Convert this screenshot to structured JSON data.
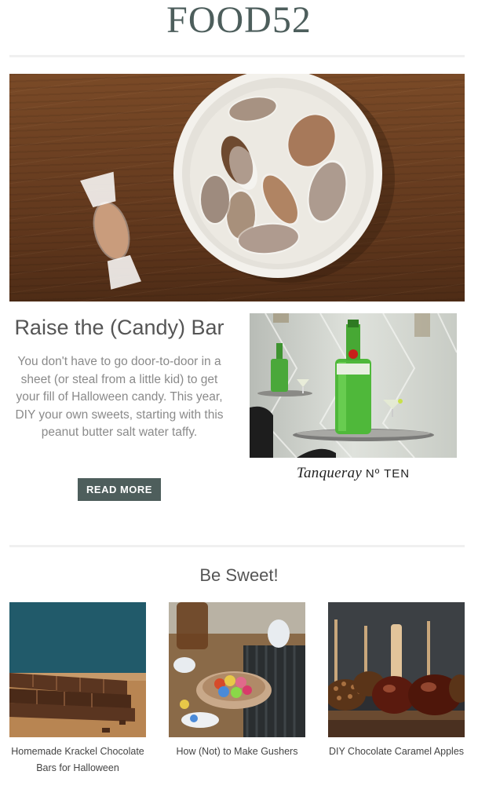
{
  "brand": {
    "logo_text": "FOOD52"
  },
  "feature": {
    "title": "Raise the (Candy) Bar",
    "body": "You don't have to go door-to-door in a sheet (or steal from a little kid) to get your fill of Halloween candy. This year, DIY your own sweets, starting with this peanut butter salt water taffy.",
    "button_label": "READ MORE"
  },
  "ad": {
    "brand_script": "Tanqueray",
    "brand_suffix": "Nº TEN"
  },
  "section": {
    "title": "Be Sweet!"
  },
  "cards": [
    {
      "caption": "Homemade Krackel Chocolate Bars for Halloween"
    },
    {
      "caption": "How (Not) to Make Gushers"
    },
    {
      "caption": "DIY Chocolate Caramel Apples"
    }
  ],
  "colors": {
    "accent": "#4e5e5c",
    "logo": "#4d5e5c",
    "text_gray": "#8a8a8a"
  }
}
